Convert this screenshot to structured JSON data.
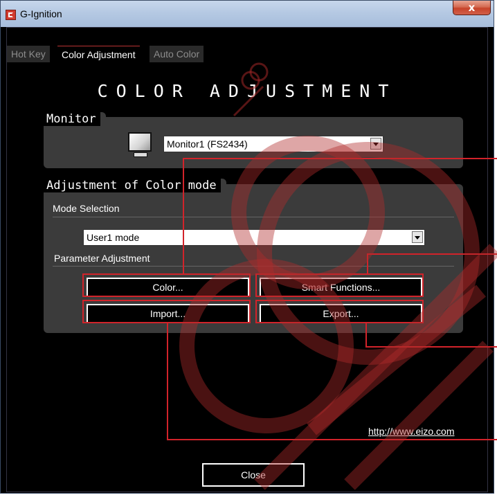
{
  "window": {
    "title": "G-Ignition",
    "close_symbol": "x"
  },
  "tabs": [
    {
      "label": "Hot Key",
      "active": false
    },
    {
      "label": "Color Adjustment",
      "active": true
    },
    {
      "label": "Auto Color",
      "active": false
    }
  ],
  "heading": "COLOR ADJUSTMENT",
  "monitor_group": {
    "label": "Monitor",
    "selected": "Monitor1 (FS2434)"
  },
  "color_mode_group": {
    "label": "Adjustment of Color mode",
    "mode_selection_label": "Mode Selection",
    "mode_selected": "User1 mode",
    "parameter_label": "Parameter Adjustment"
  },
  "buttons": {
    "color": "Color...",
    "smart_functions": "Smart Functions...",
    "import": "Import...",
    "export": "Export...",
    "close": "Close"
  },
  "link": "http://www.eizo.com",
  "colors": {
    "accent_red": "#d2232a",
    "panel": "#3b3b3b",
    "background": "#000000"
  }
}
